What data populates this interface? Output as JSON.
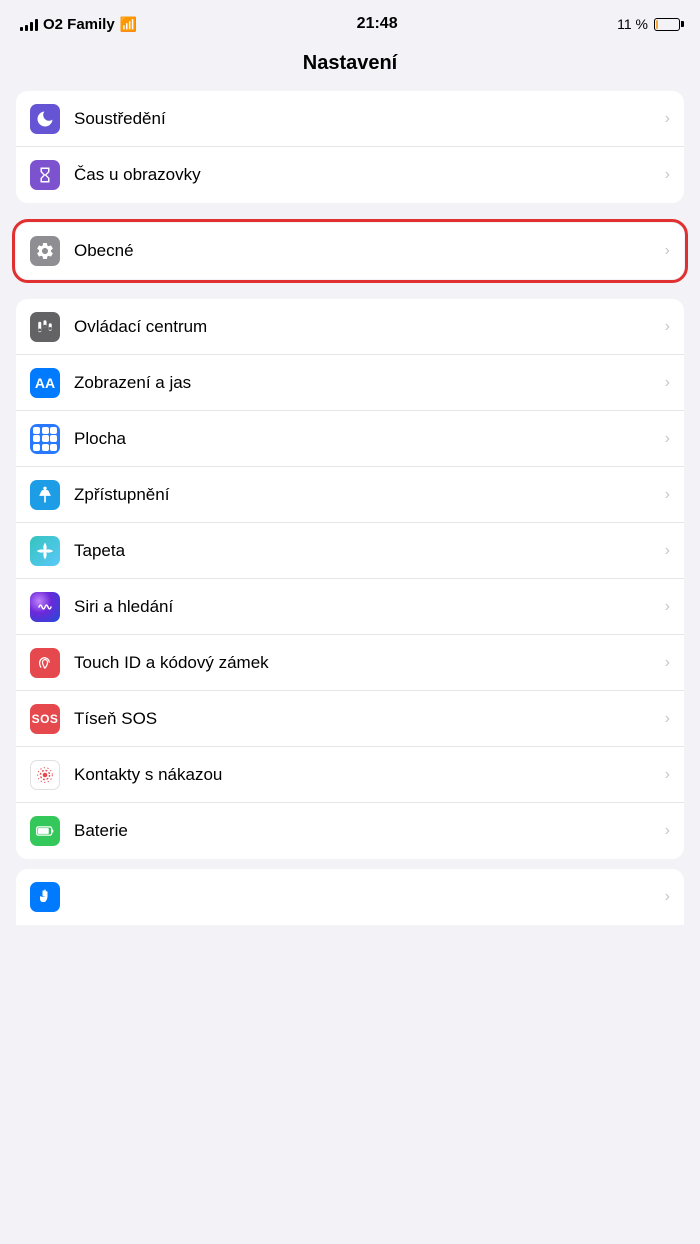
{
  "statusBar": {
    "carrier": "O2 Family",
    "time": "21:48",
    "battery_pct": "11 %"
  },
  "pageTitle": "Nastavení",
  "groups": [
    {
      "id": "group1",
      "highlighted": false,
      "rows": [
        {
          "id": "soustredeni",
          "label": "Soustředění",
          "iconBg": "blue-purple",
          "iconType": "moon"
        },
        {
          "id": "cas-u-obrazovky",
          "label": "Čas u obrazovky",
          "iconBg": "purple",
          "iconType": "hourglass"
        }
      ]
    },
    {
      "id": "group2",
      "highlighted": true,
      "rows": [
        {
          "id": "obecne",
          "label": "Obecné",
          "iconBg": "gray",
          "iconType": "gear"
        }
      ]
    },
    {
      "id": "group3",
      "highlighted": false,
      "rows": [
        {
          "id": "ovladaci-centrum",
          "label": "Ovládací centrum",
          "iconBg": "gray-dark",
          "iconType": "sliders"
        },
        {
          "id": "zobrazeni-a-jas",
          "label": "Zobrazení a jas",
          "iconBg": "blue",
          "iconType": "aa"
        },
        {
          "id": "plocha",
          "label": "Plocha",
          "iconBg": "blue-grid",
          "iconType": "grid"
        },
        {
          "id": "zpristupneni",
          "label": "Zpřístupnění",
          "iconBg": "cyan",
          "iconType": "accessibility"
        },
        {
          "id": "tapeta",
          "label": "Tapeta",
          "iconBg": "teal",
          "iconType": "flower"
        },
        {
          "id": "siri-a-hledani",
          "label": "Siri a hledání",
          "iconBg": "siri",
          "iconType": "siri"
        },
        {
          "id": "touch-id",
          "label": "Touch ID a kódový zámek",
          "iconBg": "red",
          "iconType": "fingerprint"
        },
        {
          "id": "tisen-sos",
          "label": "Tíseň SOS",
          "iconBg": "red-sos",
          "iconType": "sos"
        },
        {
          "id": "kontakty-s-nakazou",
          "label": "Kontakty s nákazou",
          "iconBg": "white",
          "iconType": "exposure"
        },
        {
          "id": "baterie",
          "label": "Baterie",
          "iconBg": "green",
          "iconType": "battery"
        }
      ]
    }
  ],
  "partialRow": {
    "id": "soukromi",
    "label": "",
    "iconBg": "blue-bottom",
    "iconType": "hand"
  },
  "chevron": "›"
}
